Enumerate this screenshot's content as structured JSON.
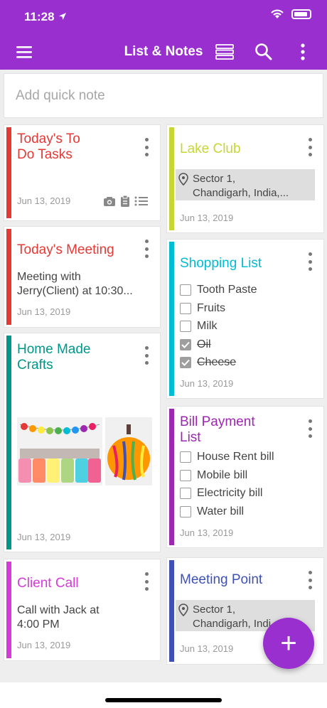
{
  "status": {
    "time": "11:28"
  },
  "appbar": {
    "title": "List & Notes"
  },
  "quick_note": {
    "placeholder": "Add quick note"
  },
  "colors": {
    "brand": "#9a2fd0",
    "red": "#e53935",
    "green": "#c7d635",
    "teal": "#009688",
    "cyan": "#00bcd4",
    "purple": "#9c27b0",
    "magenta": "#d63bd9",
    "indigo": "#3f51b5"
  },
  "cards": {
    "todo": {
      "title_line1": "Today's To",
      "title_line2": "Do Tasks",
      "date": "Jun 13, 2019"
    },
    "meeting": {
      "title": "Today's Meeting",
      "line1": "Meeting with",
      "line2": "Jerry(Client) at 10:30...",
      "date": "Jun 13, 2019"
    },
    "crafts": {
      "title_line1": "Home Made",
      "title_line2": "Crafts",
      "date": "Jun 13, 2019"
    },
    "client": {
      "title": "Client Call",
      "line1": "Call with Jack at",
      "line2": "4:00 PM",
      "date": "Jun 13, 2019"
    },
    "lake": {
      "title": "Lake Club",
      "loc_line1": "Sector 1,",
      "loc_line2": "Chandigarh, India,...",
      "date": "Jun 13, 2019"
    },
    "shopping": {
      "title": "Shopping List",
      "items": [
        {
          "label": "Tooth Paste",
          "checked": false
        },
        {
          "label": "Fruits",
          "checked": false
        },
        {
          "label": "Milk",
          "checked": false
        },
        {
          "label": "Oil",
          "checked": true
        },
        {
          "label": "Cheese",
          "checked": true
        }
      ],
      "date": "Jun 13, 2019"
    },
    "bill": {
      "title_line1": "Bill Payment",
      "title_line2": "List",
      "items": [
        {
          "label": "House Rent bill",
          "checked": false
        },
        {
          "label": "Mobile bill",
          "checked": false
        },
        {
          "label": "Electricity bill",
          "checked": false
        },
        {
          "label": "Water bill",
          "checked": false
        }
      ],
      "date": "Jun 13, 2019"
    },
    "point": {
      "title": "Meeting Point",
      "loc_line1": "Sector 1,",
      "loc_line2": "Chandigarh, Indi",
      "date": "Jun 13, 2019"
    }
  },
  "fab": {
    "label": "+"
  }
}
